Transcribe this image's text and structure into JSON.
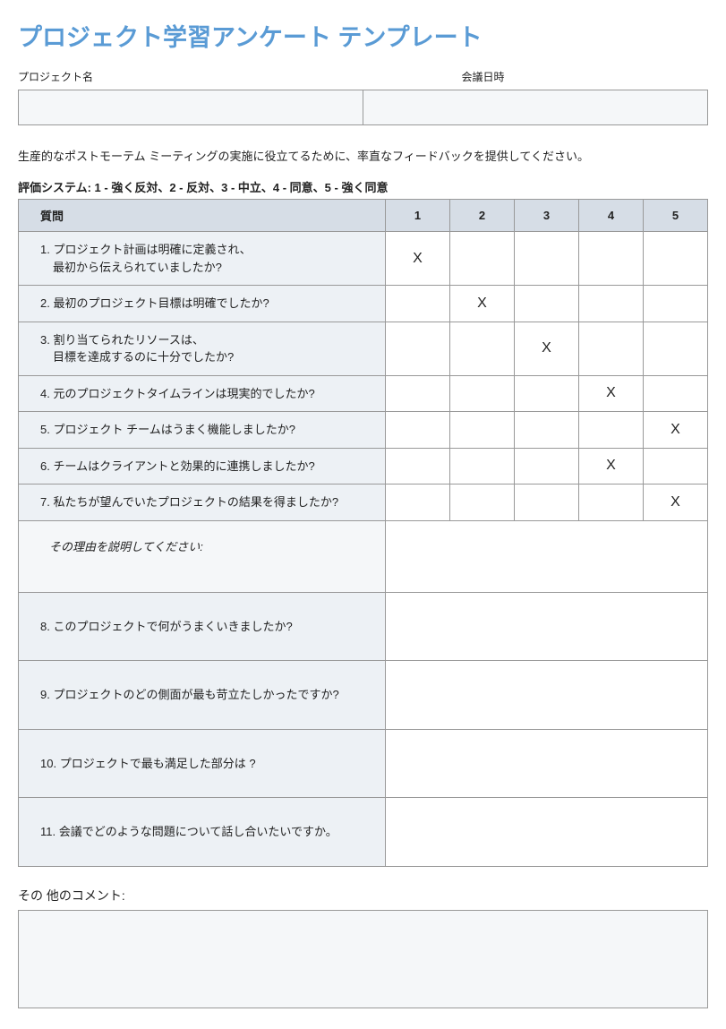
{
  "title": "プロジェクト学習アンケート テンプレート",
  "meta": {
    "project_label": "プロジェクト名",
    "project_value": "",
    "date_label": "会議日時",
    "date_value": ""
  },
  "intro": "生産的なポストモーテム ミーティングの実施に役立てるために、率直なフィードバックを提供してください。",
  "scale_label": "評価システム: 1 - 強く反対、2 - 反対、3 - 中立、4 - 同意、5 - 強く同意",
  "headers": {
    "question": "質問",
    "c1": "1",
    "c2": "2",
    "c3": "3",
    "c4": "4",
    "c5": "5"
  },
  "rated_questions": [
    {
      "num": "1.",
      "text_a": "プロジェクト計画は明確に定義され、",
      "text_b": "最初から伝えられていましたか?",
      "rating": 1
    },
    {
      "num": "2.",
      "text_a": "最初のプロジェクト目標は明確でしたか?",
      "text_b": "",
      "rating": 2
    },
    {
      "num": "3.",
      "text_a": "割り当てられたリソースは、",
      "text_b": "目標を達成するのに十分でしたか?",
      "rating": 3
    },
    {
      "num": "4.",
      "text_a": "元のプロジェクトタイムラインは現実的でしたか?",
      "text_b": "",
      "rating": 4
    },
    {
      "num": "5.",
      "text_a": "プロジェクト チームはうまく機能しましたか?",
      "text_b": "",
      "rating": 5
    },
    {
      "num": "6.",
      "text_a": "チームはクライアントと効果的に連携しましたか?",
      "text_b": "",
      "rating": 4
    },
    {
      "num": "7.",
      "text_a": "私たちが望んでいたプロジェクトの結果を得ましたか?",
      "text_b": "",
      "rating": 5
    }
  ],
  "mark": "X",
  "explain_label": "その理由を説明してください:",
  "open_questions": [
    {
      "num": "8.",
      "text": "このプロジェクトで何がうまくいきましたか?"
    },
    {
      "num": "9.",
      "text": "プロジェクトのどの側面が最も苛立たしかったですか?"
    },
    {
      "num": "10.",
      "text": "プロジェクトで最も満足した部分は ?"
    },
    {
      "num": "11.",
      "text": "会議でどのような問題について話し合いたいですか。"
    }
  ],
  "comments_label": "その 他のコメント:",
  "comments_value": ""
}
